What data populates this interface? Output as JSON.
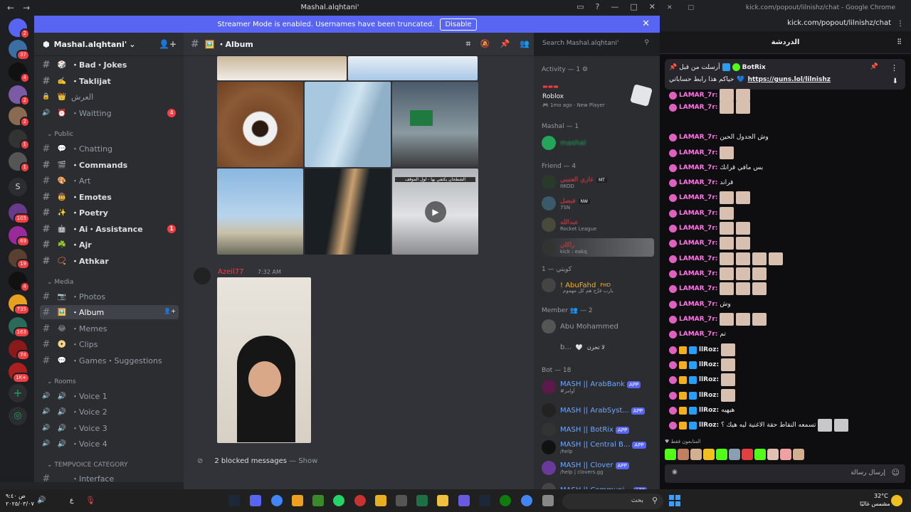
{
  "window": {
    "title": "Mashal.alqhtani'",
    "controls": [
      "▭",
      "?",
      "—",
      "□",
      "✕"
    ]
  },
  "banner": {
    "text": "Streamer Mode is enabled. Usernames have been truncated.",
    "button": "Disable",
    "close": "✕"
  },
  "rail": {
    "badges": [
      "2",
      "37",
      "4",
      "2",
      "2",
      "1",
      "1",
      "105",
      "69",
      "19",
      "4",
      "735",
      "163",
      "74",
      "1K+"
    ],
    "letter": "S"
  },
  "guild": {
    "name": "Mashal.alqhtani'",
    "chevron": "⌄"
  },
  "channels": [
    {
      "emoji": "🎲",
      "label": "・Bad・Jokes",
      "style": "bright"
    },
    {
      "emoji": "✍️",
      "label": "・Taklijat",
      "style": "bright"
    },
    {
      "emoji": "👑",
      "label": "العرش",
      "style": "dim",
      "icon": "lock"
    },
    {
      "emoji": "⏰",
      "label": "・Waitting",
      "style": "dim",
      "icon": "voice",
      "count": "4"
    },
    {
      "emoji": "💬",
      "label": "・Chatting",
      "style": "dim"
    },
    {
      "emoji": "🎬",
      "label": "・Commands",
      "style": "bright"
    },
    {
      "emoji": "🎨",
      "label": "・Art",
      "style": "dim"
    },
    {
      "emoji": "🤠",
      "label": "・Emotes",
      "style": "bright"
    },
    {
      "emoji": "✨",
      "label": "・Poetry",
      "style": "bright"
    },
    {
      "emoji": "🤖",
      "label": "・Ai・Assistance",
      "style": "bright",
      "count": "1"
    },
    {
      "emoji": "☘️",
      "label": "・Ajr",
      "style": "bright"
    },
    {
      "emoji": "📿",
      "label": "・Athkar",
      "style": "bright"
    },
    {
      "emoji": "📷",
      "label": "・Photos",
      "style": "dim"
    },
    {
      "emoji": "🖼️",
      "label": "・Album",
      "style": "sel"
    },
    {
      "emoji": "😂",
      "label": "・Memes",
      "style": "dim"
    },
    {
      "emoji": "📀",
      "label": "・Clips",
      "style": "dim"
    },
    {
      "emoji": "💬",
      "label": "・Games・Suggestions",
      "style": "dim"
    },
    {
      "emoji": "🔊",
      "label": "・Voice 1",
      "style": "dim",
      "icon": "voice"
    },
    {
      "emoji": "🔊",
      "label": "・Voice 2",
      "style": "dim",
      "icon": "voice"
    },
    {
      "emoji": "🔊",
      "label": "・Voice 3",
      "style": "dim",
      "icon": "voice"
    },
    {
      "emoji": "🔊",
      "label": "・Voice 4",
      "style": "dim",
      "icon": "voice"
    },
    {
      "emoji": "",
      "label": "・Interface",
      "style": "dim"
    }
  ],
  "categories": [
    "Public",
    "Media",
    "Rooms",
    "TEMPVOICE CATEGORY"
  ],
  "chat": {
    "channel": "Album",
    "search_placeholder": "Search Mashal.alqhtani'",
    "message_author": "Azeil77",
    "message_time": "7:32 AM",
    "sign_text_1": "الشطحان يكتفي بها - لول الموقف",
    "blocked": "2 blocked messages",
    "blocked_action": "— Show"
  },
  "members": {
    "activity_header": "Activity — 1",
    "activity_game": "Roblox",
    "activity_meta": "1mo ago",
    "activity_tag": "New Player",
    "mashal_header": "Mashal — 1",
    "mashal_name": "mashal",
    "friend_header": "Friend — 4",
    "friends": [
      {
        "name": "غازي العتيبي",
        "tag": "MT",
        "sub": "ItKOD"
      },
      {
        "name": "فيصل",
        "tag": "NW",
        "sub": "7SN"
      },
      {
        "name": "عبدالله",
        "tag": "",
        "sub": "Rocket League"
      },
      {
        "name": "راكان",
        "tag": "",
        "sub": "kick : eakq"
      }
    ],
    "kwaiti_header": "كويتي — 1",
    "kwaiti_name": "! AbuFahd",
    "kwaiti_tag": "FHD",
    "kwaiti_sub": "يارب‌ فرِّج‌ هم‌ كل‌ مهموم",
    "member_header": "Member",
    "member_count": "— 2",
    "member_names": [
      "Abu Mohammed",
      "b..."
    ],
    "member2_status": "لا تحزن",
    "bot_header": "Bot — 18",
    "bots": [
      {
        "name": "MASH || ArabBank",
        "sub": "#أوامر"
      },
      {
        "name": "MASH || ArabSyst...",
        "sub": ""
      },
      {
        "name": "MASH || BotRix",
        "sub": ""
      },
      {
        "name": "MASH || Central B...",
        "sub": "/help"
      },
      {
        "name": "MASH || Clover",
        "sub": "/help | clovers.gg"
      },
      {
        "name": "MASH || Communi...",
        "sub": ""
      }
    ],
    "app_label": "APP"
  },
  "chrome": {
    "title": "kick.com/popout/lilnishz/chat - Google Chrome",
    "url": "kick.com/popout/lilnishz/chat",
    "chat_header": "الدردشة",
    "pinned_author": "BotRix",
    "pinned_prefix": "أرسلت من قبل",
    "pinned_text": "حياكم هذا رابط حساباتي",
    "pinned_link": "https://guns.lol/lilnishz",
    "messages": [
      {
        "user": "LAMAR_7r:",
        "text": "",
        "emotes": 2
      },
      {
        "user": "LAMAR_7r:",
        "text": "",
        "emotes": 2
      },
      {
        "user": "LAMAR_7r:",
        "text": "وش الجدول الحين",
        "emotes": 0
      },
      {
        "user": "LAMAR_7r:",
        "text": "",
        "emotes": 1
      },
      {
        "user": "LAMAR_7r:",
        "text": "بس مافي قرانك",
        "emotes": 0
      },
      {
        "user": "LAMAR_7r:",
        "text": "قراند",
        "emotes": 0
      },
      {
        "user": "LAMAR_7r:",
        "text": "",
        "emotes": 2
      },
      {
        "user": "LAMAR_7r:",
        "text": "",
        "emotes": 1
      },
      {
        "user": "LAMAR_7r:",
        "text": "",
        "emotes": 2
      },
      {
        "user": "LAMAR_7r:",
        "text": "",
        "emotes": 2
      },
      {
        "user": "LAMAR_7r:",
        "text": "",
        "emotes": 4
      },
      {
        "user": "LAMAR_7r:",
        "text": "",
        "emotes": 3
      },
      {
        "user": "LAMAR_7r:",
        "text": "",
        "emotes": 3
      },
      {
        "user": "LAMAR_7r:",
        "text": "وش",
        "emotes": 0
      },
      {
        "user": "LAMAR_7r:",
        "text": "",
        "emotes": 3
      },
      {
        "user": "LAMAR_7r:",
        "text": "تم",
        "emotes": 0
      },
      {
        "user": "llRoz:",
        "text": "",
        "emotes": 1
      },
      {
        "user": "llRoz:",
        "text": "",
        "emotes": 1
      },
      {
        "user": "llRoz:",
        "text": "",
        "emotes": 1
      },
      {
        "user": "llRoz:",
        "text": "",
        "emotes": 1
      },
      {
        "user": "llRoz:",
        "text": "هيهيه",
        "emotes": 0
      },
      {
        "user": "llRoz:",
        "text": "تسمعه النقاط حقة الاغنية ليه هيك ؟",
        "emotes": 2
      }
    ],
    "subs_only": "المتابعون فقط",
    "input_placeholder": "إرسال رسالة"
  },
  "taskbar": {
    "time": "ص ٩:٤٠",
    "date": "٢٠٢٥/٠٣/٠٧",
    "lang": "ع",
    "search": "بحث",
    "weather_temp": "32°C",
    "weather_desc": "مشمس غالبًا"
  },
  "colors": {
    "blurple": "#5865f2",
    "kick_green": "#53fc18",
    "red": "#f23f43"
  }
}
